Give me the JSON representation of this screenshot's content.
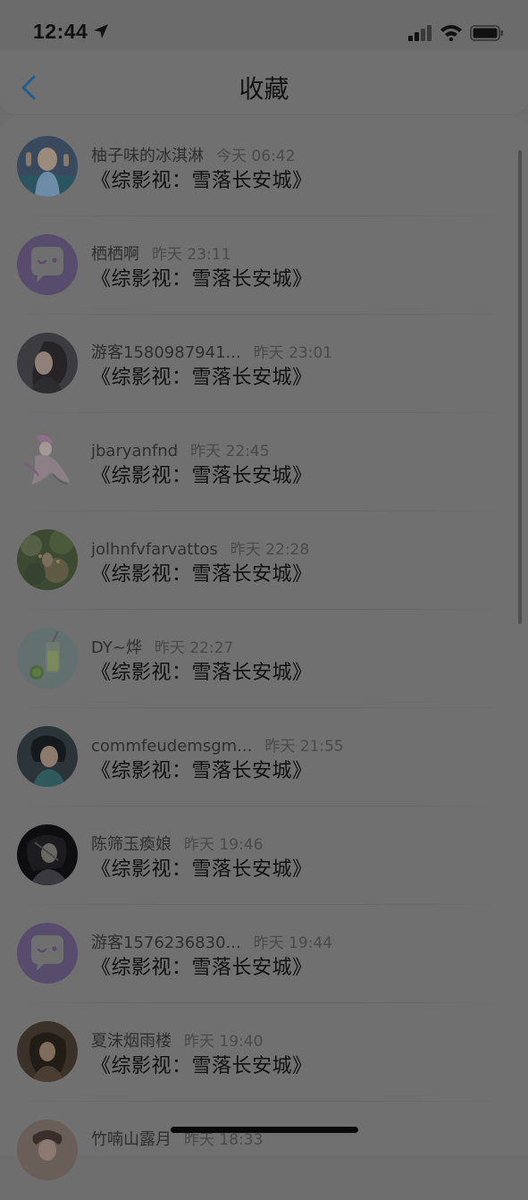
{
  "status": {
    "time": "12:44"
  },
  "nav": {
    "title": "收藏"
  },
  "items": [
    {
      "name": "柚子味的冰淇淋",
      "time": "今天 06:42",
      "title": "《综影视：雪落长安城》",
      "avatar": "photo-person-1"
    },
    {
      "name": "栖栖啊",
      "time": "昨天 23:11",
      "title": "《综影视：雪落长安城》",
      "avatar": "default-chat"
    },
    {
      "name": "游客1580987941...",
      "time": "昨天 23:01",
      "title": "《综影视：雪落长安城》",
      "avatar": "photo-person-2"
    },
    {
      "name": "jbaryanfnd",
      "time": "昨天 22:45",
      "title": "《综影视：雪落长安城》",
      "avatar": "illustration-figure"
    },
    {
      "name": "jolhnfvfarvattos",
      "time": "昨天 22:28",
      "title": "《综影视：雪落长安城》",
      "avatar": "photo-garden"
    },
    {
      "name": "DY~烨",
      "time": "昨天 22:27",
      "title": "《综影视：雪落长安城》",
      "avatar": "photo-drink"
    },
    {
      "name": "commfeudemsgm...",
      "time": "昨天 21:55",
      "title": "《综影视：雪落长安城》",
      "avatar": "photo-person-3"
    },
    {
      "name": "陈筛玉瘓娘",
      "time": "昨天 19:46",
      "title": "《综影视：雪落长安城》",
      "avatar": "illustration-dark"
    },
    {
      "name": "游客1576236830...",
      "time": "昨天 19:44",
      "title": "《综影视：雪落长安城》",
      "avatar": "default-chat"
    },
    {
      "name": "夏沫烟雨楼",
      "time": "昨天 19:40",
      "title": "《综影视：雪落长安城》",
      "avatar": "photo-person-4"
    },
    {
      "name": "竹喃山露月",
      "time": "昨天 18:33",
      "title": "",
      "avatar": "photo-person-5"
    }
  ]
}
